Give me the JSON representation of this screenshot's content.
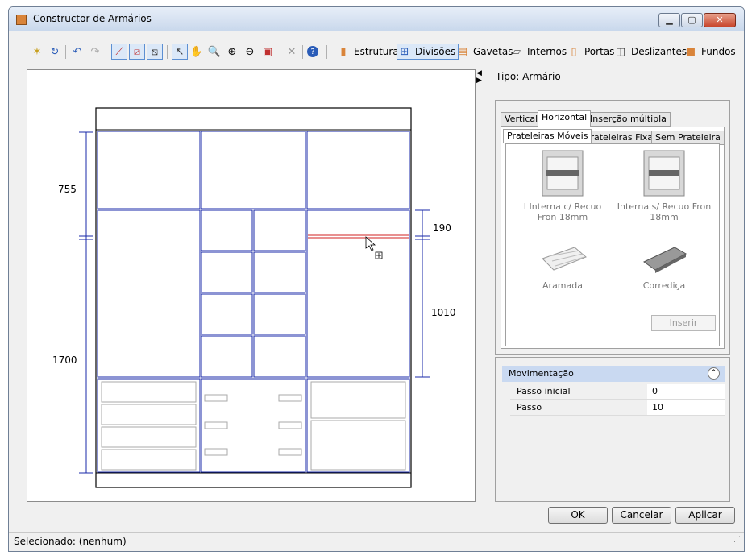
{
  "window": {
    "title": "Constructor de Armários"
  },
  "toolbar": {
    "estrutura": "Estrutura",
    "divisoes": "Divisões",
    "gavetas": "Gavetas",
    "internos": "Internos",
    "portas": "Portas",
    "deslizantes": "Deslizantes",
    "fundos": "Fundos"
  },
  "canvas": {
    "dims": {
      "d755": "755",
      "d1700": "1700",
      "d190": "190",
      "d1010": "1010"
    }
  },
  "tipo": "Tipo: Armário",
  "tabs": {
    "vertical": "Vertical",
    "horizontal": "Horizontal",
    "insercao": "Inserção múltipla"
  },
  "subtabs": {
    "moveis": "Prateleiras Móveis",
    "fixas": "Prateleiras Fixas",
    "sem": "Sem Prateleira"
  },
  "items": [
    {
      "label": "I Interna c/ Recuo Fron 18mm"
    },
    {
      "label": "Interna s/ Recuo Fron 18mm"
    },
    {
      "label": "Aramada"
    },
    {
      "label": "Corrediça"
    }
  ],
  "inserir": "Inserir",
  "movimentacao": {
    "title": "Movimentação",
    "rows": [
      {
        "key": "Passo inicial",
        "value": "0"
      },
      {
        "key": "Passo",
        "value": "10"
      }
    ]
  },
  "buttons": {
    "ok": "OK",
    "cancelar": "Cancelar",
    "aplicar": "Aplicar"
  },
  "status": "Selecionado: (nenhum)"
}
